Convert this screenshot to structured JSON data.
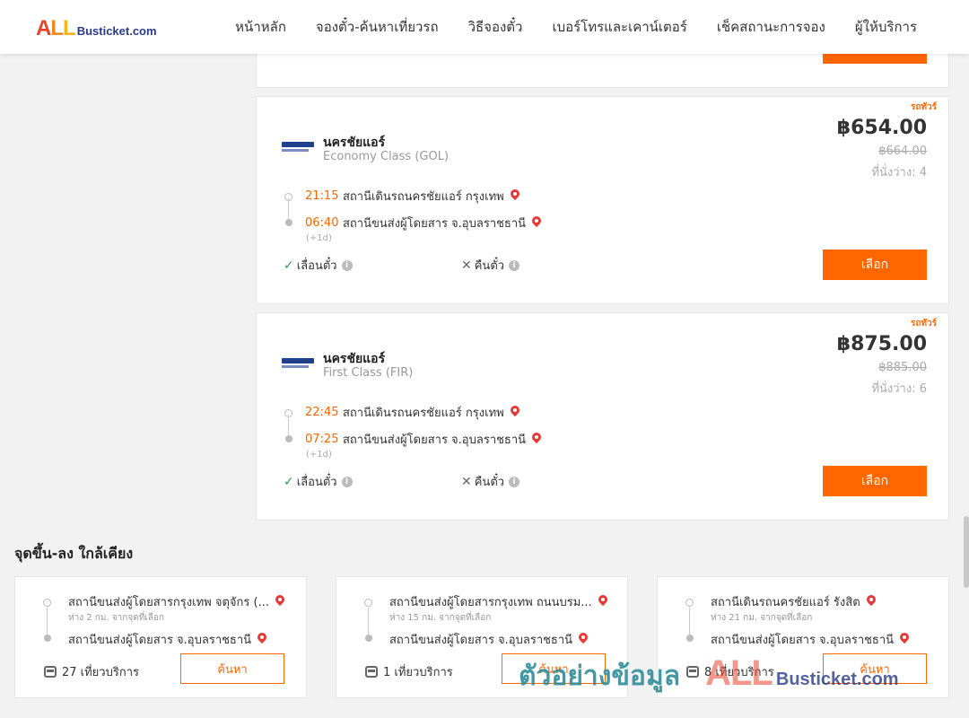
{
  "logo": {
    "all": "ALL",
    "rest": "Busticket.com"
  },
  "nav": [
    "หน้าหลัก",
    "จองตั๋ว-ค้นหาเที่ยวรถ",
    "วิธีจองตั๋ว",
    "เบอร์โทรและเคาน์เตอร์",
    "เช็คสถานะการจอง",
    "ผู้ให้บริการ"
  ],
  "trips": [
    {
      "tag": "รถทัวร์",
      "operator": "นครชัยแอร์",
      "class": "Economy Class (GOL)",
      "price": "฿654.00",
      "old_price": "฿664.00",
      "seats": "ที่นั่งว่าง: 4",
      "depart_time": "21:15",
      "depart_station": "สถานีเดินรถนครชัยแอร์ กรุงเทพ",
      "arrive_time": "06:40",
      "arrive_station": "สถานีขนส่งผู้โดยสาร จ.อุบลราชธานี",
      "plus_day": "(+1d)",
      "reschedule": "เลื่อนตั๋ว",
      "refund": "คืนตั๋ว",
      "select_label": "เลือก"
    },
    {
      "tag": "รถทัวร์",
      "operator": "นครชัยแอร์",
      "class": "First Class (FIR)",
      "price": "฿875.00",
      "old_price": "฿885.00",
      "seats": "ที่นั่งว่าง: 6",
      "depart_time": "22:45",
      "depart_station": "สถานีเดินรถนครชัยแอร์ กรุงเทพ",
      "arrive_time": "07:25",
      "arrive_station": "สถานีขนส่งผู้โดยสาร จ.อุบลราชธานี",
      "plus_day": "(+1d)",
      "reschedule": "เลื่อนตั๋ว",
      "refund": "คืนตั๋ว",
      "select_label": "เลือก"
    }
  ],
  "nearby": {
    "title": "จุดขึ้น-ลง ใกล้เคียง",
    "items": [
      {
        "from": "สถานีขนส่งผู้โดยสารกรุงเทพ จตุจักร (...",
        "distance": "ห่าง 2 กม. จากจุดที่เลือก",
        "to": "สถานีขนส่งผู้โดยสาร จ.อุบลราชธานี",
        "trips": "27 เที่ยวบริการ",
        "search_label": "ค้นหา"
      },
      {
        "from": "สถานีขนส่งผู้โดยสารกรุงเทพ ถนนบรม...",
        "distance": "ห่าง 15 กม. จากจุดที่เลือก",
        "to": "สถานีขนส่งผู้โดยสาร จ.อุบลราชธานี",
        "trips": "1 เที่ยวบริการ",
        "search_label": "ค้นหา"
      },
      {
        "from": "สถานีเดินรถนครชัยแอร์ รังสิต",
        "distance": "ห่าง 21 กม. จากจุดที่เลือก",
        "to": "สถานีขนส่งผู้โดยสาร จ.อุบลราชธานี",
        "trips": "8 เที่ยวบริการ",
        "search_label": "ค้นหา"
      }
    ]
  },
  "watermark": {
    "thai": "ตัวอย่างข้อมูล",
    "all": "ALL",
    "rest": "Busticket.com"
  },
  "colors": {
    "accent": "#ff6600",
    "time": "#ff6600",
    "ok": "#2e9e3e",
    "pin": "#e53935"
  }
}
